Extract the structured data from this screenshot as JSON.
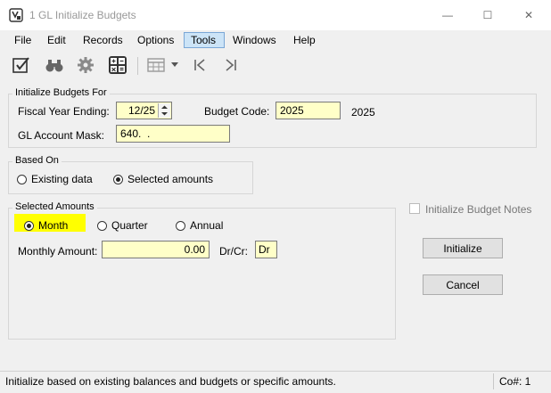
{
  "window": {
    "title": "1 GL Initialize Budgets",
    "controls": {
      "minimize": "—",
      "maximize": "☐",
      "close": "✕"
    }
  },
  "menu": {
    "items": [
      "File",
      "Edit",
      "Records",
      "Options",
      "Tools",
      "Windows",
      "Help"
    ],
    "active": "Tools"
  },
  "toolbar": {
    "icons": [
      "check-edit-icon",
      "binoculars-icon",
      "gear-icon",
      "calculator-icon",
      "table-grid-icon",
      "dropdown-arrow-icon",
      "first-record-icon",
      "last-record-icon"
    ]
  },
  "init_for": {
    "title": "Initialize Budgets For",
    "fiscal_label": "Fiscal Year Ending:",
    "fiscal_value": "12/25",
    "budget_code_label": "Budget Code:",
    "budget_code_value": "2025",
    "budget_code_desc": "2025",
    "mask_label": "GL Account Mask:",
    "mask_value": "640.  ."
  },
  "based_on": {
    "title": "Based On",
    "options": [
      "Existing data",
      "Selected amounts"
    ],
    "selected": "Selected amounts"
  },
  "selected_amounts": {
    "title": "Selected Amounts",
    "periods": [
      "Month",
      "Quarter",
      "Annual"
    ],
    "selected_period": "Month",
    "amount_label": "Monthly Amount:",
    "amount_value": "0.00",
    "drcr_label": "Dr/Cr:",
    "drcr_value": "Dr"
  },
  "notes": {
    "label": "Initialize Budget Notes",
    "checked": false
  },
  "buttons": {
    "initialize": "Initialize",
    "cancel": "Cancel"
  },
  "status": {
    "message": "Initialize based on existing balances and budgets or specific amounts.",
    "company": "Co#: 1"
  },
  "colors": {
    "field_bg": "#ffffc8",
    "highlight": "#ffff00",
    "menu_active": "#cce4f7"
  }
}
